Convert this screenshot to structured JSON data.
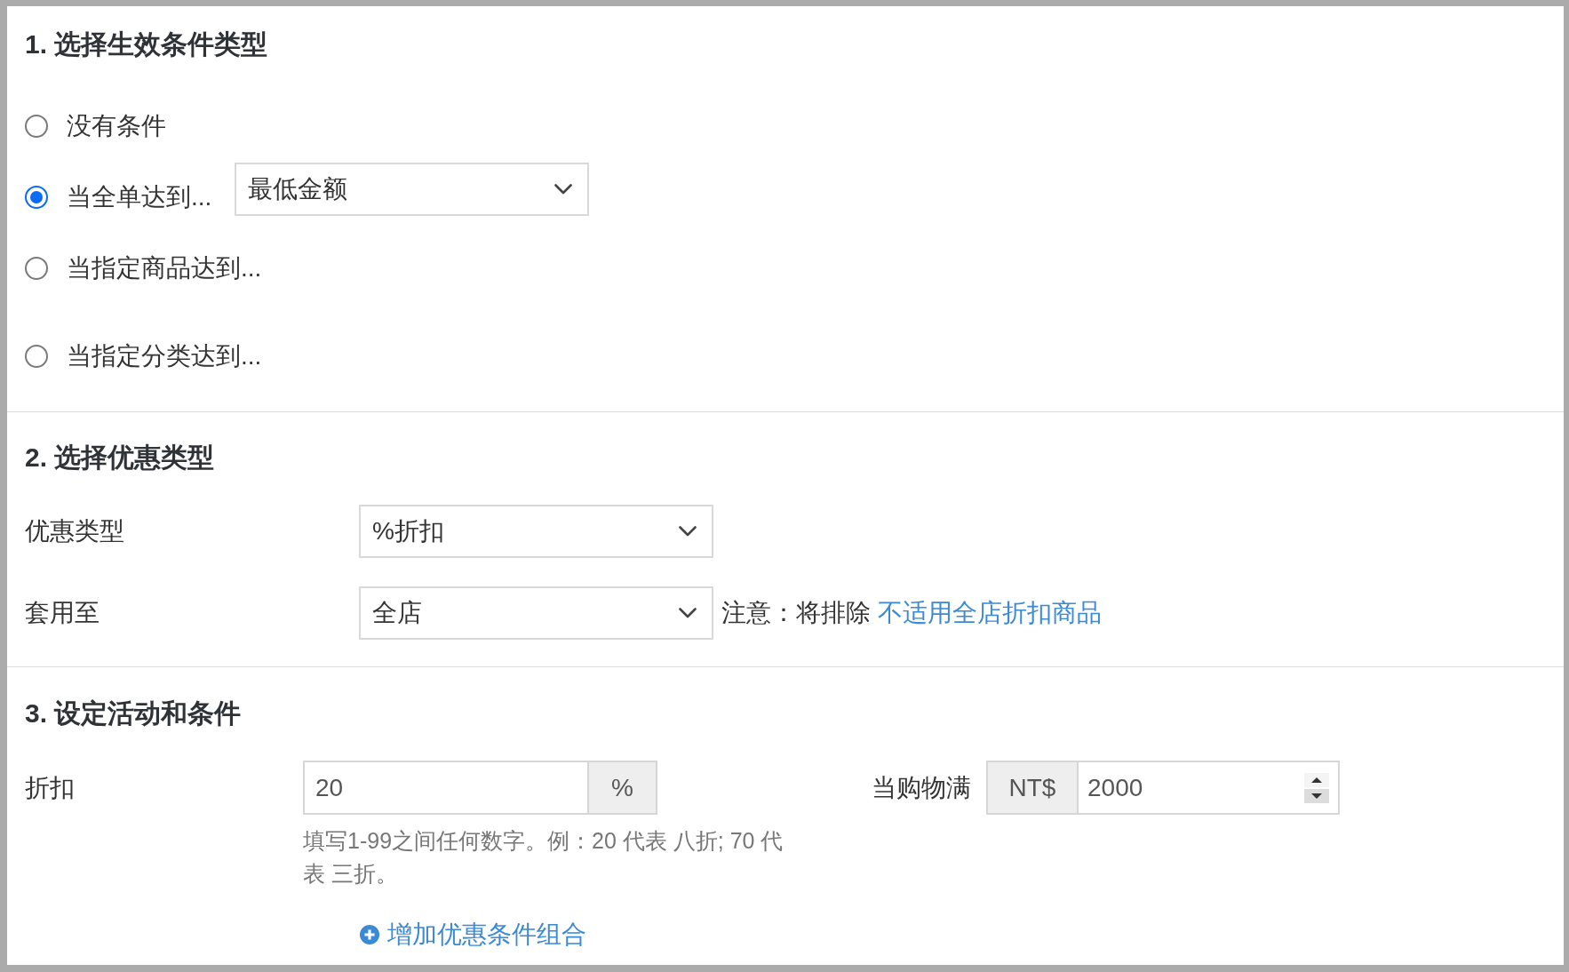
{
  "conditions": {
    "title": "1. 选择生效条件类型",
    "options": [
      {
        "label": "没有条件",
        "selected": false
      },
      {
        "label": "当全单达到...",
        "selected": true,
        "select": {
          "value": "最低金额"
        }
      },
      {
        "label": "当指定商品达到...",
        "selected": false
      },
      {
        "label": "当指定分类达到...",
        "selected": false
      }
    ]
  },
  "discount_type": {
    "title": "2. 选择优惠类型",
    "fields": [
      {
        "label": "优惠类型",
        "select": {
          "value": "%折扣"
        }
      },
      {
        "label": "套用至",
        "select": {
          "value": "全店"
        },
        "note": "注意：将排除",
        "note_link": "不适用全店折扣商品"
      }
    ]
  },
  "rules": {
    "title": "3. 设定活动和条件",
    "discount": {
      "label": "折扣",
      "value": "20",
      "suffix": "%",
      "help": "填写1-99之间任何数字。例：20 代表 八折; 70 代表 三折。"
    },
    "threshold": {
      "label": "当购物满",
      "prefix": "NT$",
      "value": "2000"
    },
    "add_link": "增加优惠条件组合"
  }
}
